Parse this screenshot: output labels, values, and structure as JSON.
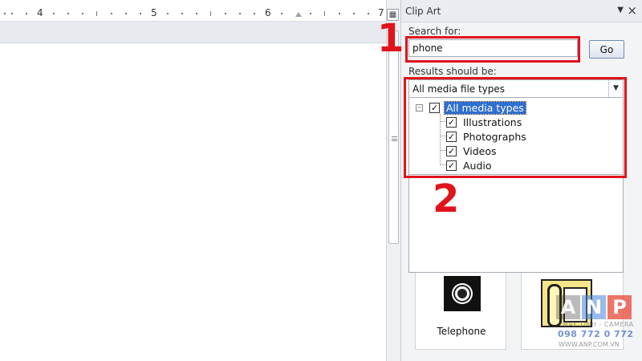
{
  "ruler": {
    "numbers": [
      "4",
      "5",
      "6",
      "7"
    ]
  },
  "ruler_toggle_icon": "view-ruler-icon",
  "pane": {
    "title": "Clip Art",
    "menu_icon": "dropdown-arrow-icon",
    "close_icon": "close-icon"
  },
  "search": {
    "label": "Search for:",
    "value": "phone",
    "go_label": "Go"
  },
  "results": {
    "label": "Results should be:",
    "selected": "All media file types",
    "tree": {
      "root": {
        "label": "All media types",
        "checked": true,
        "expanded": true
      },
      "children": [
        {
          "label": "Illustrations",
          "checked": true
        },
        {
          "label": "Photographs",
          "checked": true
        },
        {
          "label": "Videos",
          "checked": true
        },
        {
          "label": "Audio",
          "checked": true
        }
      ]
    }
  },
  "thumbnails": [
    {
      "label": "Telephone",
      "icon": "audio-disc-icon"
    },
    {
      "label": "",
      "icon": "telephone-clipart-icon"
    }
  ],
  "annotations": {
    "step1": "1",
    "step2": "2",
    "color": "#e0141c"
  },
  "watermark": {
    "letters": [
      "A",
      "N",
      "P"
    ],
    "tagline": "MÁY TÍNH - CAMERA",
    "phone": "098 772 0 772",
    "site": "WWW.ANP.COM.VN"
  },
  "colors": {
    "selection": "#2f6fd1",
    "go_border": "#6f8db3"
  }
}
